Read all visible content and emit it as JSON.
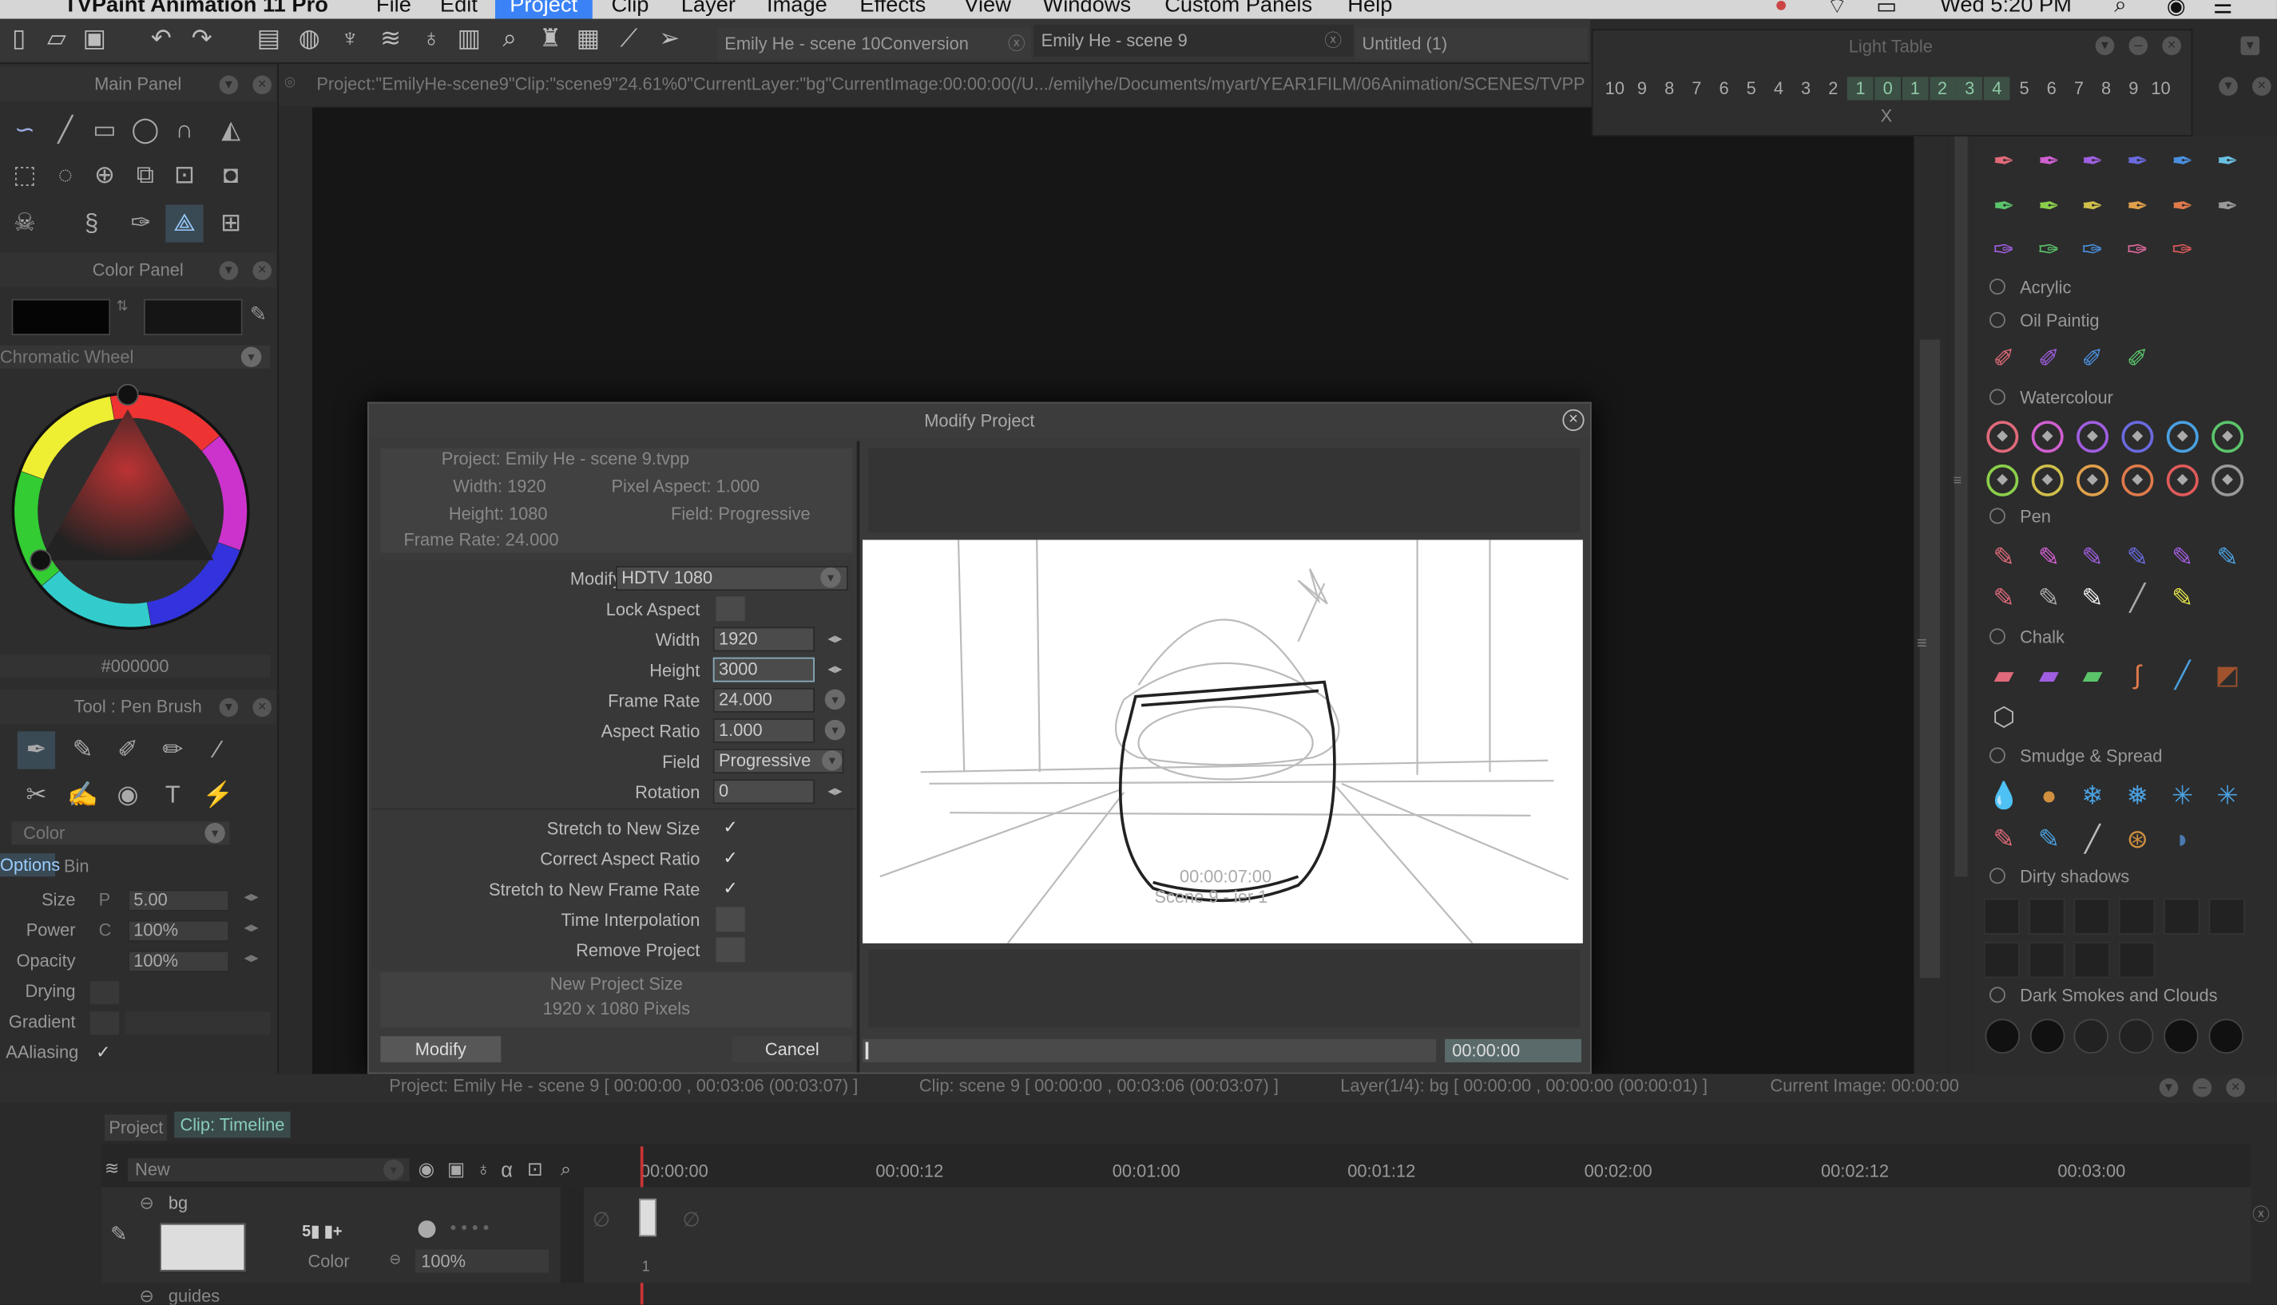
{
  "menubar": {
    "app": "TVPaint Animation 11 Pro",
    "items": [
      "File",
      "Edit",
      "Project",
      "Clip",
      "Layer",
      "Image",
      "Effects",
      "View",
      "Windows",
      "Custom Panels",
      "Help"
    ],
    "active": "Project",
    "time": "Wed 5:20 PM"
  },
  "tabs": [
    {
      "label": "Emily He - scene 10Conversion"
    },
    {
      "label": "Emily He - scene 9"
    },
    {
      "label": "Untitled (1)"
    }
  ],
  "pathbar": {
    "text": "Project:\"EmilyHe-scene9\"Clip:\"scene9\"24.61%0\"CurrentLayer:\"bg\"CurrentImage:00:00:00(/U.../emilyhe/Documents/myart/YEAR1FILM/06Animation/SCENES/TVPP"
  },
  "left": {
    "main_panel": "Main Panel",
    "color_panel": "Color Panel",
    "chromatic": "Chromatic Wheel",
    "hex": "#000000",
    "tool_title": "Tool : Pen Brush",
    "color_dd": "Color",
    "options_tab": "Options",
    "bin_tab": "Bin",
    "size_label": "Size",
    "size_val": "5.00",
    "size_p": "P",
    "power_label": "Power",
    "power_val": "100%",
    "power_c": "C",
    "opacity_label": "Opacity",
    "opacity_val": "100%",
    "drying_label": "Drying",
    "gradient_label": "Gradient",
    "aaliasing_label": "AAliasing",
    "aaliasing_check": "✓"
  },
  "lighttable": {
    "title": "Light Table",
    "numbers": [
      "10",
      "9",
      "8",
      "7",
      "6",
      "5",
      "4",
      "3",
      "2",
      "1",
      "0",
      "1",
      "2",
      "3",
      "4",
      "5",
      "6",
      "7",
      "8",
      "9",
      "10"
    ],
    "x": "X"
  },
  "right": {
    "sections": [
      "Acrylic",
      "Oil Paintig",
      "Watercolour",
      "Pen",
      "Chalk",
      "Smudge & Spread",
      "Dirty shadows",
      "Dark Smokes and Clouds"
    ]
  },
  "dialog": {
    "title": "Modify Project",
    "info": {
      "project": "Project: Emily He - scene 9.tvpp",
      "width": "Width: 1920",
      "pixel_aspect": "Pixel Aspect: 1.000",
      "height": "Height: 1080",
      "field": "Field: Progressive",
      "frame_rate": "Frame Rate: 24.000"
    },
    "modify_to_label": "Modify Project to",
    "modify_to_value": "HDTV 1080",
    "lock_aspect": "Lock Aspect",
    "width_label": "Width",
    "width_value": "1920",
    "height_label": "Height",
    "height_value": "3000",
    "frame_rate_label": "Frame Rate",
    "frame_rate_value": "24.000",
    "aspect_label": "Aspect Ratio",
    "aspect_value": "1.000",
    "field_label": "Field",
    "field_value": "Progressive",
    "rotation_label": "Rotation",
    "rotation_value": "0",
    "stretch_size": "Stretch to New Size",
    "correct_aspect": "Correct Aspect Ratio",
    "stretch_rate": "Stretch to New Frame Rate",
    "time_interp": "Time Interpolation",
    "remove_project": "Remove Project",
    "check": "✓",
    "new_size_title": "New Project Size",
    "new_size_value": "1920 x 1080 Pixels",
    "modify_btn": "Modify",
    "cancel_btn": "Cancel",
    "preview_time": "00:00:00",
    "preview_overlay": "00:00:07:00",
    "preview_overlay2": "Scene 9 - ier 1"
  },
  "timeline": {
    "project_info": "Project: Emily He - scene 9 [ 00:00:00 , 00:03:06  (00:03:07) ]",
    "clip_info": "Clip: scene 9 [ 00:00:00 , 00:03:06  (00:03:07) ]",
    "layer_info": "Layer(1/4): bg [ 00:00:00 , 00:00:00  (00:00:01) ]",
    "current_image": "Current Image: 00:00:00",
    "tab_project": "Project",
    "tab_clip": "Clip: Timeline",
    "new_layer": "New",
    "ruler": [
      "00:00:00",
      "00:00:12",
      "00:01:00",
      "00:01:12",
      "00:02:00",
      "00:02:12",
      "00:03:00"
    ],
    "layer_bg": "bg",
    "layer_color": "Color",
    "layer_opacity": "100%",
    "layer_guides": "guides",
    "frame_num": "1"
  }
}
